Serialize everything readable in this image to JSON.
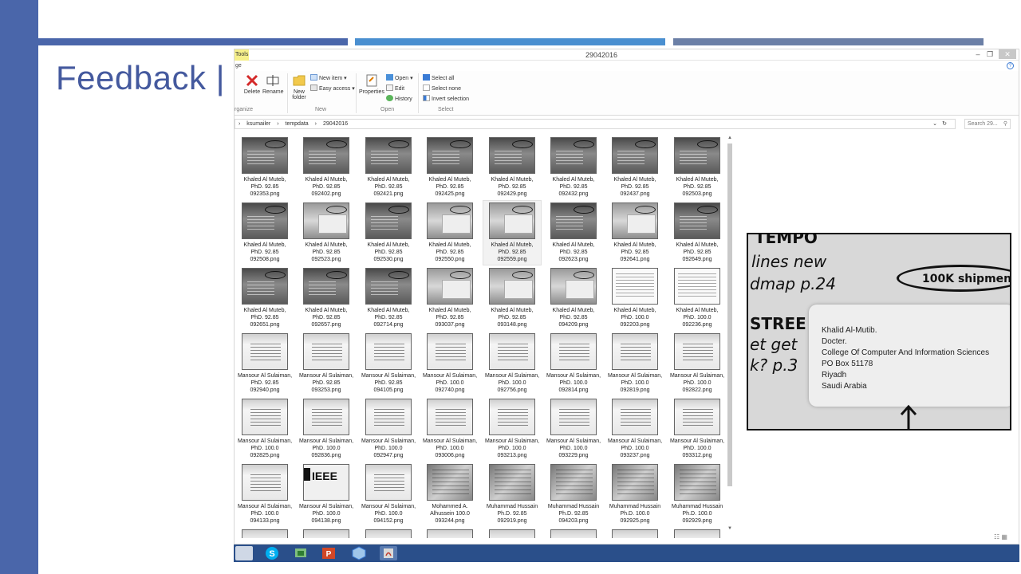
{
  "slide": {
    "title": "Feedback |",
    "accent_color": "#4a66aa",
    "rules": [
      "#4a66aa",
      "#4a8fd0",
      "#6b7fa6"
    ]
  },
  "explorer": {
    "tools_tab": "Tools",
    "window_title": "29042016",
    "tab_fragment": "ge",
    "ribbon": {
      "organize": {
        "label": "rganize",
        "delete": "Delete",
        "rename": "Rename"
      },
      "new": {
        "label": "New",
        "new_folder": "New folder",
        "new_item": "New item",
        "easy_access": "Easy access"
      },
      "open": {
        "label": "Open",
        "properties": "Properties",
        "open_btn": "Open",
        "edit": "Edit",
        "history": "History"
      },
      "select": {
        "label": "Select",
        "select_all": "Select all",
        "select_none": "Select none",
        "invert": "Invert selection"
      }
    },
    "address": {
      "path": [
        "ksumailer",
        "tempdata",
        "29042016"
      ],
      "search_placeholder": "Search 29..."
    },
    "files": [
      {
        "name": "Khaled Al Muteb, PhD. 92.85 092353.png",
        "thumb": "dark"
      },
      {
        "name": "Khaled Al Muteb, PhD. 92.85 092402.png",
        "thumb": "dark"
      },
      {
        "name": "Khaled Al Muteb, PhD. 92.85 092421.png",
        "thumb": "dark"
      },
      {
        "name": "Khaled Al Muteb, PhD. 92.85 092425.png",
        "thumb": "dark"
      },
      {
        "name": "Khaled Al Muteb, PhD. 92.85 092429.png",
        "thumb": "dark"
      },
      {
        "name": "Khaled Al Muteb, PhD. 92.85 092432.png",
        "thumb": "dark"
      },
      {
        "name": "Khaled Al Muteb, PhD. 92.85 092437.png",
        "thumb": "dark"
      },
      {
        "name": "Khaled Al Muteb, PhD. 92.85 092503.png",
        "thumb": "dark"
      },
      {
        "name": "Khaled Al Muteb, PhD. 92.85 092508.png",
        "thumb": "dark"
      },
      {
        "name": "Khaled Al Muteb, PhD. 92.85 092523.png",
        "thumb": "mid"
      },
      {
        "name": "Khaled Al Muteb, PhD. 92.85 092530.png",
        "thumb": "dark"
      },
      {
        "name": "Khaled Al Muteb, PhD. 92.85 092550.png",
        "thumb": "mid"
      },
      {
        "name": "Khaled Al Muteb, PhD. 92.85 092559.png",
        "thumb": "mid",
        "selected": true
      },
      {
        "name": "Khaled Al Muteb, PhD. 92.85 092623.png",
        "thumb": "dark"
      },
      {
        "name": "Khaled Al Muteb, PhD. 92.85 092641.png",
        "thumb": "mid"
      },
      {
        "name": "Khaled Al Muteb, PhD. 92.85 092649.png",
        "thumb": "dark"
      },
      {
        "name": "Khaled Al Muteb, PhD. 92.85 092651.png",
        "thumb": "dark"
      },
      {
        "name": "Khaled Al Muteb, PhD. 92.85 092657.png",
        "thumb": "dark"
      },
      {
        "name": "Khaled Al Muteb, PhD. 92.85 092714.png",
        "thumb": "dark"
      },
      {
        "name": "Khaled Al Muteb, PhD. 92.85 093037.png",
        "thumb": "mid"
      },
      {
        "name": "Khaled Al Muteb, PhD. 92.85 093148.png",
        "thumb": "mid"
      },
      {
        "name": "Khaled Al Muteb, PhD. 92.85 094209.png",
        "thumb": "mid"
      },
      {
        "name": "Khaled Al Muteb, PhD. 100.0 092203.png",
        "thumb": "light"
      },
      {
        "name": "Khaled Al Muteb, PhD. 100.0 092236.png",
        "thumb": "light"
      },
      {
        "name": "Mansour Al Sulaiman, PhD. 92.85 092940.png",
        "thumb": "paper"
      },
      {
        "name": "Mansour Al Sulaiman, PhD. 92.85 093253.png",
        "thumb": "paper"
      },
      {
        "name": "Mansour Al Sulaiman, PhD. 92.85 094105.png",
        "thumb": "paper"
      },
      {
        "name": "Mansour Al Sulaiman, PhD. 100.0 092740.png",
        "thumb": "paper"
      },
      {
        "name": "Mansour Al Sulaiman, PhD. 100.0 092756.png",
        "thumb": "paper"
      },
      {
        "name": "Mansour Al Sulaiman, PhD. 100.0 092814.png",
        "thumb": "paper"
      },
      {
        "name": "Mansour Al Sulaiman, PhD. 100.0 092819.png",
        "thumb": "paper"
      },
      {
        "name": "Mansour Al Sulaiman, PhD. 100.0 092822.png",
        "thumb": "paper"
      },
      {
        "name": "Mansour Al Sulaiman, PhD. 100.0 092825.png",
        "thumb": "paper"
      },
      {
        "name": "Mansour Al Sulaiman, PhD. 100.0 092836.png",
        "thumb": "paper"
      },
      {
        "name": "Mansour Al Sulaiman, PhD. 100.0 092947.png",
        "thumb": "paper"
      },
      {
        "name": "Mansour Al Sulaiman, PhD. 100.0 093006.png",
        "thumb": "paper"
      },
      {
        "name": "Mansour Al Sulaiman, PhD. 100.0 093213.png",
        "thumb": "paper"
      },
      {
        "name": "Mansour Al Sulaiman, PhD. 100.0 093229.png",
        "thumb": "paper"
      },
      {
        "name": "Mansour Al Sulaiman, PhD. 100.0 093237.png",
        "thumb": "paper"
      },
      {
        "name": "Mansour Al Sulaiman, PhD. 100.0 093312.png",
        "thumb": "paper"
      },
      {
        "name": "Mansour Al Sulaiman, PhD. 100.0 094133.png",
        "thumb": "paper"
      },
      {
        "name": "Mansour Al Sulaiman, PhD. 100.0 094138.png",
        "thumb": "ieee"
      },
      {
        "name": "Mansour Al Sulaiman, PhD. 100.0 094152.png",
        "thumb": "paper"
      },
      {
        "name": "Mohammed A. Alhussein 100.0 093244.png",
        "thumb": "envelope"
      },
      {
        "name": "Muhammad Hussain Ph.D. 92.85 092919.png",
        "thumb": "envelope"
      },
      {
        "name": "Muhammad Hussain Ph.D. 92.85 094203.png",
        "thumb": "envelope"
      },
      {
        "name": "Muhammad Hussain Ph.D. 100.0 092925.png",
        "thumb": "envelope"
      },
      {
        "name": "Muhammad Hussain Ph.D. 100.0 092929.png",
        "thumb": "envelope"
      }
    ],
    "preview": {
      "handwriting": [
        "TEMPO",
        "lines new",
        "dmap p.24",
        "100K shipmen",
        "STREE",
        "et get",
        "k? p.3"
      ],
      "address_lines": [
        "Khalid Al-Mutib.",
        "Docter.",
        "College Of Computer And Information Sciences",
        "PO Box 51178",
        "Riyadh",
        "Saudi Arabia"
      ]
    }
  },
  "taskbar": {
    "items": [
      "file-explorer-icon",
      "skype-icon",
      "network-icon",
      "powerpoint-icon",
      "box-app-icon",
      "java-icon"
    ],
    "colors": [
      "#cfd8e6",
      "#00aff0",
      "#4caf50",
      "#d24726",
      "#9fc6ea",
      "#d9d9d9"
    ]
  }
}
